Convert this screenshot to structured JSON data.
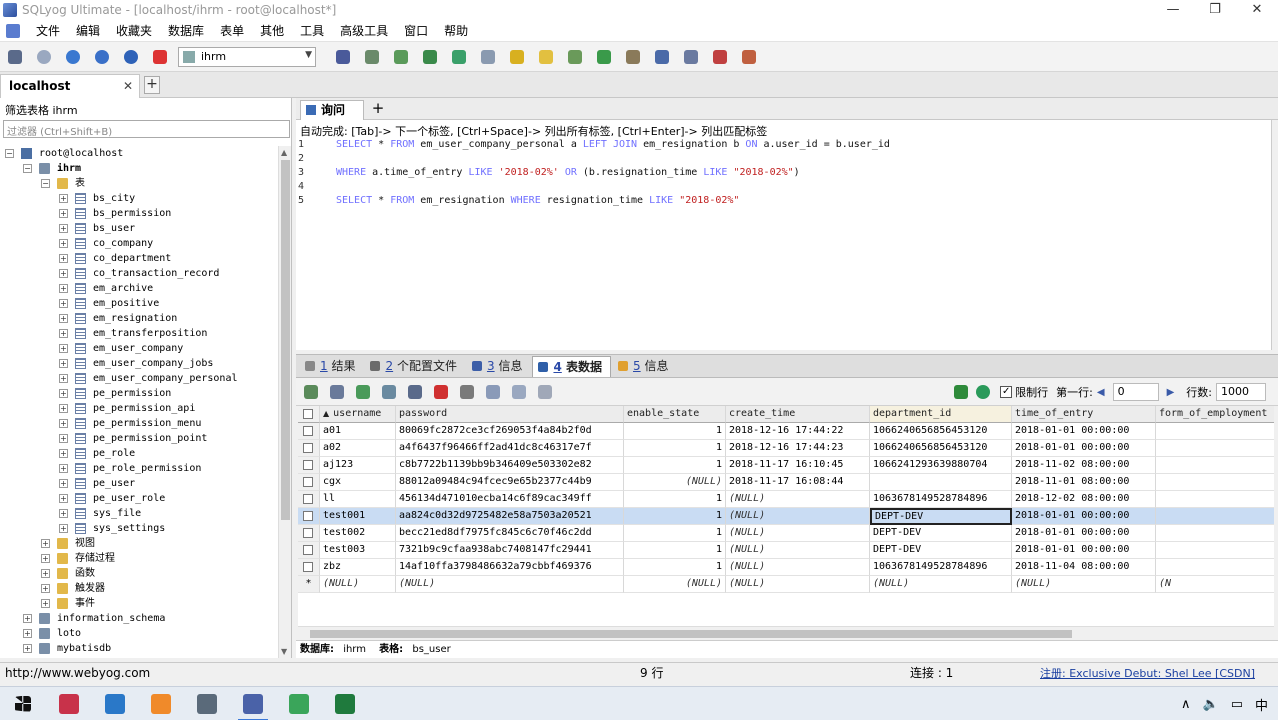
{
  "window": {
    "title": "SQLyog Ultimate - [localhost/ihrm - root@localhost*]",
    "buttons": [
      "—",
      "❐",
      "✕"
    ]
  },
  "menu": [
    "文件",
    "编辑",
    "收藏夹",
    "数据库",
    "表单",
    "其他",
    "工具",
    "高级工具",
    "窗口",
    "帮助"
  ],
  "toolbar": {
    "selected_db": "ihrm"
  },
  "connection_tab": {
    "label": "localhost",
    "close": "✕",
    "add": "+"
  },
  "left_panel": {
    "filter_label": "筛选表格  ihrm",
    "filter_placeholder": "过滤器 (Ctrl+Shift+B)",
    "tree": [
      {
        "label": "root@localhost",
        "icon": "server",
        "level": 0,
        "toggle": "−"
      },
      {
        "label": "ihrm",
        "icon": "db",
        "level": 1,
        "toggle": "−",
        "bold": true
      },
      {
        "label": "表",
        "icon": "folder",
        "level": 2,
        "toggle": "−"
      },
      {
        "label": "bs_city",
        "icon": "table",
        "level": 3,
        "toggle": "+"
      },
      {
        "label": "bs_permission",
        "icon": "table",
        "level": 3,
        "toggle": "+"
      },
      {
        "label": "bs_user",
        "icon": "table",
        "level": 3,
        "toggle": "+"
      },
      {
        "label": "co_company",
        "icon": "table",
        "level": 3,
        "toggle": "+"
      },
      {
        "label": "co_department",
        "icon": "table",
        "level": 3,
        "toggle": "+"
      },
      {
        "label": "co_transaction_record",
        "icon": "table",
        "level": 3,
        "toggle": "+"
      },
      {
        "label": "em_archive",
        "icon": "table",
        "level": 3,
        "toggle": "+"
      },
      {
        "label": "em_positive",
        "icon": "table",
        "level": 3,
        "toggle": "+"
      },
      {
        "label": "em_resignation",
        "icon": "table",
        "level": 3,
        "toggle": "+"
      },
      {
        "label": "em_transferposition",
        "icon": "table",
        "level": 3,
        "toggle": "+"
      },
      {
        "label": "em_user_company",
        "icon": "table",
        "level": 3,
        "toggle": "+"
      },
      {
        "label": "em_user_company_jobs",
        "icon": "table",
        "level": 3,
        "toggle": "+"
      },
      {
        "label": "em_user_company_personal",
        "icon": "table",
        "level": 3,
        "toggle": "+"
      },
      {
        "label": "pe_permission",
        "icon": "table",
        "level": 3,
        "toggle": "+"
      },
      {
        "label": "pe_permission_api",
        "icon": "table",
        "level": 3,
        "toggle": "+"
      },
      {
        "label": "pe_permission_menu",
        "icon": "table",
        "level": 3,
        "toggle": "+"
      },
      {
        "label": "pe_permission_point",
        "icon": "table",
        "level": 3,
        "toggle": "+"
      },
      {
        "label": "pe_role",
        "icon": "table",
        "level": 3,
        "toggle": "+"
      },
      {
        "label": "pe_role_permission",
        "icon": "table",
        "level": 3,
        "toggle": "+"
      },
      {
        "label": "pe_user",
        "icon": "table",
        "level": 3,
        "toggle": "+"
      },
      {
        "label": "pe_user_role",
        "icon": "table",
        "level": 3,
        "toggle": "+"
      },
      {
        "label": "sys_file",
        "icon": "table",
        "level": 3,
        "toggle": "+"
      },
      {
        "label": "sys_settings",
        "icon": "table",
        "level": 3,
        "toggle": "+"
      },
      {
        "label": "视图",
        "icon": "folder",
        "level": 2,
        "toggle": "+"
      },
      {
        "label": "存储过程",
        "icon": "folder",
        "level": 2,
        "toggle": "+"
      },
      {
        "label": "函数",
        "icon": "folder",
        "level": 2,
        "toggle": "+"
      },
      {
        "label": "触发器",
        "icon": "folder",
        "level": 2,
        "toggle": "+"
      },
      {
        "label": "事件",
        "icon": "folder",
        "level": 2,
        "toggle": "+"
      },
      {
        "label": "information_schema",
        "icon": "db",
        "level": 1,
        "toggle": "+"
      },
      {
        "label": "loto",
        "icon": "db",
        "level": 1,
        "toggle": "+"
      },
      {
        "label": "mybatisdb",
        "icon": "db",
        "level": 1,
        "toggle": "+"
      }
    ]
  },
  "query": {
    "tab_label": "询问",
    "add": "+",
    "hint": "自动完成: [Tab]-> 下一个标签, [Ctrl+Space]-> 列出所有标签, [Ctrl+Enter]-> 列出匹配标签",
    "lines": [
      {
        "n": "1",
        "parts": [
          [
            "kw",
            "SELECT"
          ],
          [
            "nm",
            " * "
          ],
          [
            "kw",
            "FROM"
          ],
          [
            "nm",
            " em_user_company_personal a "
          ],
          [
            "kw",
            "LEFT JOIN"
          ],
          [
            "nm",
            " em_resignation b "
          ],
          [
            "kw",
            "ON"
          ],
          [
            "nm",
            " a.user_id = b.user_id"
          ]
        ]
      },
      {
        "n": "2",
        "parts": []
      },
      {
        "n": "3",
        "parts": [
          [
            "kw",
            "WHERE"
          ],
          [
            "nm",
            " a.time_of_entry "
          ],
          [
            "kw",
            "LIKE"
          ],
          [
            "nm",
            " "
          ],
          [
            "str",
            "'2018-02%'"
          ],
          [
            "nm",
            " "
          ],
          [
            "kw",
            "OR"
          ],
          [
            "nm",
            " (b.resignation_time "
          ],
          [
            "kw",
            "LIKE"
          ],
          [
            "nm",
            " "
          ],
          [
            "str",
            "\"2018-02%\""
          ],
          [
            "nm",
            ")"
          ]
        ]
      },
      {
        "n": "4",
        "parts": []
      },
      {
        "n": "5",
        "parts": [
          [
            "kw",
            "SELECT"
          ],
          [
            "nm",
            " * "
          ],
          [
            "kw",
            "FROM"
          ],
          [
            "nm",
            " em_resignation "
          ],
          [
            "kw",
            "WHERE"
          ],
          [
            "nm",
            " resignation_time "
          ],
          [
            "kw",
            "LIKE"
          ],
          [
            "nm",
            " "
          ],
          [
            "str",
            "\"2018-02%\""
          ]
        ]
      }
    ]
  },
  "result_tabs": [
    {
      "num": "1",
      "label": "结果",
      "color": "#888888"
    },
    {
      "num": "2",
      "label": "个配置文件",
      "color": "#6b6b6b"
    },
    {
      "num": "3",
      "label": "信息",
      "color": "#3c5ea8"
    },
    {
      "num": "4",
      "label": "表数据",
      "color": "#2f5fa8",
      "active": true
    },
    {
      "num": "5",
      "label": "信息",
      "color": "#e0a030"
    }
  ],
  "result_toolbar": {
    "limit_label": "限制行",
    "limit_checked": "✓",
    "first_row_label": "第一行:",
    "first_row_value": "0",
    "rows_label": "行数:",
    "rows_value": "1000"
  },
  "grid": {
    "columns": [
      "username",
      "password",
      "enable_state",
      "create_time",
      "department_id",
      "time_of_entry",
      "form_of_employment"
    ],
    "sort_indicator": "▲",
    "rows": [
      [
        "a01",
        "80069fc2872ce3cf269053f4a84b2f0d",
        "1",
        "2018-12-16 17:44:22",
        "1066240656856453120",
        "2018-01-01 00:00:00",
        ""
      ],
      [
        "a02",
        "a4f6437f96466ff2ad41dc8c46317e7f",
        "1",
        "2018-12-16 17:44:23",
        "1066240656856453120",
        "2018-01-01 00:00:00",
        ""
      ],
      [
        "aj123",
        "c8b7722b1139bb9b346409e503302e82",
        "1",
        "2018-11-17 16:10:45",
        "1066241293639880704",
        "2018-11-02 08:00:00",
        ""
      ],
      [
        "cgx",
        "88012a09484c94fcec9e65b2377c44b9",
        "(NULL)",
        "2018-11-17 16:08:44",
        "",
        "2018-11-01 08:00:00",
        ""
      ],
      [
        "ll",
        "456134d471010ecba14c6f89cac349ff",
        "1",
        "(NULL)",
        "1063678149528784896",
        "2018-12-02 08:00:00",
        ""
      ],
      [
        "test001",
        "aa824c0d32d9725482e58a7503a20521",
        "1",
        "(NULL)",
        "DEPT-DEV",
        "2018-01-01 00:00:00",
        ""
      ],
      [
        "test002",
        "becc21ed8df7975fc845c6c70f46c2dd",
        "1",
        "(NULL)",
        "DEPT-DEV",
        "2018-01-01 00:00:00",
        ""
      ],
      [
        "test003",
        "7321b9c9cfaa938abc7408147fc29441",
        "1",
        "(NULL)",
        "DEPT-DEV",
        "2018-01-01 00:00:00",
        ""
      ],
      [
        "zbz",
        "14af10ffa3798486632a79cbbf469376",
        "1",
        "(NULL)",
        "1063678149528784896",
        "2018-11-04 08:00:00",
        ""
      ]
    ],
    "new_row": [
      "(NULL)",
      "(NULL)",
      "(NULL)",
      "(NULL)",
      "(NULL)",
      "(NULL)",
      "(N"
    ],
    "new_row_marker": "*",
    "selected_row": 5
  },
  "info_bar": {
    "db_label": "数据库:",
    "db_value": "ihrm",
    "table_label": "表格:",
    "table_value": "bs_user"
  },
  "status": {
    "url": "http://www.webyog.com",
    "rows": "9 行",
    "connection": "连接 : 1",
    "registration": "注册:  Exclusive Debut: Shel Lee [CSDN]"
  },
  "taskbar": {
    "apps": [
      {
        "name": "windows-start",
        "color": "#111111"
      },
      {
        "name": "intellij",
        "color": "#c8324a"
      },
      {
        "name": "vscode",
        "color": "#2a78c8"
      },
      {
        "name": "sublime",
        "color": "#f08a2a"
      },
      {
        "name": "explorer",
        "color": "#5a6a7a"
      },
      {
        "name": "sqlyog",
        "color": "#4a62a8"
      },
      {
        "name": "chrome",
        "color": "#3aa55a"
      },
      {
        "name": "excel",
        "color": "#1f7a3d"
      }
    ],
    "tray": [
      "∧",
      "🔈",
      "▭",
      "中"
    ]
  }
}
